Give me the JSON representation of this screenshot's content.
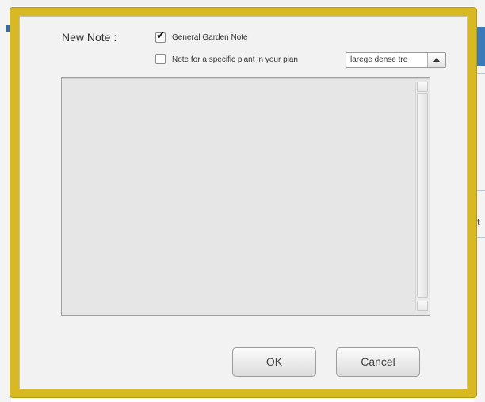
{
  "dialog": {
    "new_note_label": "New Note :",
    "options": {
      "general": {
        "label": "General Garden Note",
        "checked": true
      },
      "specific": {
        "label": "Note  for a specific plant in your plan",
        "checked": false
      }
    },
    "plant_select": {
      "value": "larege dense tre"
    },
    "note_text": {
      "value": ""
    },
    "buttons": {
      "ok": "OK",
      "cancel": "Cancel"
    },
    "background_char": "t"
  },
  "colors": {
    "frame": "#d8b823",
    "body": "#f2f2f2",
    "textarea": "#e6e6e6"
  }
}
